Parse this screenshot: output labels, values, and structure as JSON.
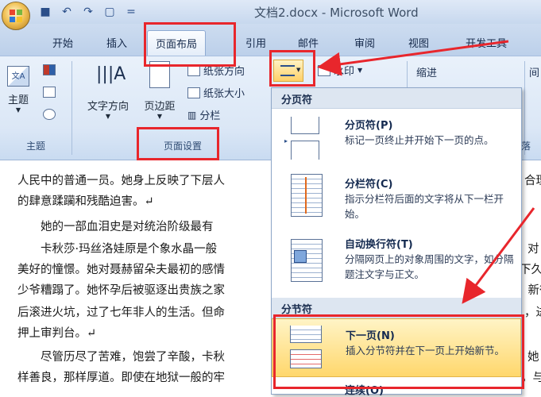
{
  "window": {
    "title": "文档2.docx - Microsoft Word",
    "qat_icons": [
      "save-icon",
      "undo-icon",
      "redo-icon",
      "print-preview-icon",
      "customize-qat-icon"
    ],
    "qat_glyphs": [
      "■",
      "↶",
      "↷",
      "▢",
      "="
    ]
  },
  "tabs": [
    {
      "label": "开始"
    },
    {
      "label": "插入"
    },
    {
      "label": "页面布局"
    },
    {
      "label": "引用"
    },
    {
      "label": "邮件"
    },
    {
      "label": "审阅"
    },
    {
      "label": "视图"
    },
    {
      "label": "开发工具"
    }
  ],
  "ribbon": {
    "theme_group": {
      "button": "主题",
      "label": "主题"
    },
    "page_setup_group": {
      "text_direction": "文字方向",
      "margins": "页边距",
      "orientation": "纸张方向",
      "size": "纸张大小",
      "columns": "分栏",
      "label": "页面设置"
    },
    "watermark": "水印",
    "indent": "缩进",
    "spacing_partial": "间",
    "group_partial": "落"
  },
  "menu": {
    "section1": "分页符",
    "section2": "分节符",
    "items": [
      {
        "title": "分页符(P)",
        "desc": "标记一页终止并开始下一页的点。"
      },
      {
        "title": "分栏符(C)",
        "desc": "指示分栏符后面的文字将从下一栏开始。"
      },
      {
        "title": "自动换行符(T)",
        "desc": "分隔网页上的对象周围的文字，如分隔题注文字与正文。"
      },
      {
        "title": "下一页(N)",
        "desc": "插入分节符并在下一页上开始新节。"
      }
    ],
    "partial_next": "连续(O)"
  },
  "document": {
    "lines": [
      "人民中的普通一员。她身上反映了下层人",
      "的肆意蹂躏和残酷迫害。↵",
      "　　她的一部血泪史是对统治阶级最有",
      "　　卡秋莎·玛丝洛娃原是个象水晶一般",
      "美好的憧憬。她对聂赫留朵夫最初的感情",
      "少爷糟蹋了。她怀孕后被驱逐出贵族之家",
      "后滚进火坑，过了七年非人的生活。但命",
      "押上审判台。↵",
      "　　尽管历尽了苦难，饱尝了辛酸，卡秋",
      "样善良，那样厚道。即使在地狱一般的牢"
    ],
    "right_fragments": [
      "合理",
      "对",
      "下久",
      "，新往",
      "，进",
      "她",
      "。与"
    ]
  },
  "colors": {
    "annotation_red": "#e8262c",
    "highlight": "#ffd76c",
    "ribbon_blue": "#dbe7f6"
  }
}
